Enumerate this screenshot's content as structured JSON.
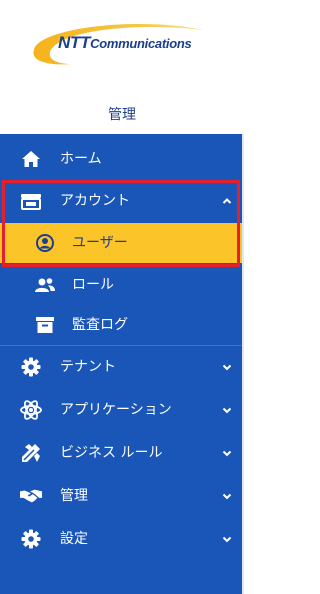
{
  "logo": {
    "brand_bold": "NTT",
    "brand_rest": "Communications"
  },
  "section_title": "管理",
  "nav": {
    "items": [
      {
        "label": "ホーム",
        "icon": "home-icon"
      },
      {
        "label": "アカウント",
        "icon": "account-card-icon",
        "expanded": true
      },
      {
        "label": "テナント",
        "icon": "gear-icon"
      },
      {
        "label": "アプリケーション",
        "icon": "atom-icon"
      },
      {
        "label": "ビジネス ルール",
        "icon": "tools-icon"
      },
      {
        "label": "管理",
        "icon": "handshake-icon"
      },
      {
        "label": "設定",
        "icon": "gear-icon"
      }
    ],
    "sub_items": [
      {
        "label": "ユーザー",
        "icon": "user-circle-icon",
        "active": true
      },
      {
        "label": "ロール",
        "icon": "users-icon"
      },
      {
        "label": "監査ログ",
        "icon": "archive-icon"
      }
    ]
  },
  "colors": {
    "nav_bg": "#1a56b8",
    "active_bg": "#fbc52a",
    "highlight_border": "#e3202b",
    "title": "#1e3f8c"
  }
}
